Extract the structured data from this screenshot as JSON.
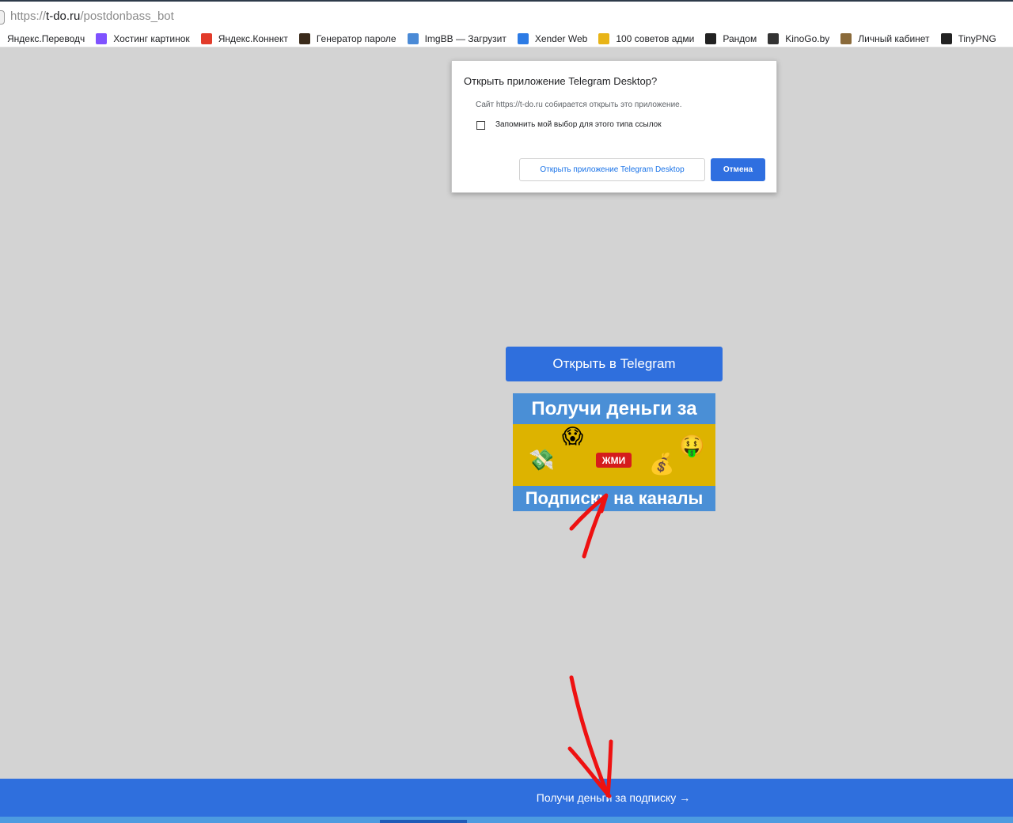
{
  "browser": {
    "url_prefix": "https://",
    "url_host": "t-do.ru",
    "url_path": "/postdonbass_bot",
    "bookmarks": [
      {
        "label": "Яндекс.Переводч",
        "icon": "yandex-translate-icon",
        "color": "#ffffff"
      },
      {
        "label": "Хостинг картинок",
        "icon": "kotlin-k-icon",
        "color": "#7f52ff"
      },
      {
        "label": "Яндекс.Коннект",
        "icon": "yandex-connect-icon",
        "color": "#e23b2a"
      },
      {
        "label": "Генератор пароле",
        "icon": "cookie-icon",
        "color": "#3a2a1a"
      },
      {
        "label": "ImgBB — Загрузит",
        "icon": "imgbb-icon",
        "color": "#4a8ad6"
      },
      {
        "label": "Xender Web",
        "icon": "xender-icon",
        "color": "#2c7be5"
      },
      {
        "label": "100 советов адми",
        "icon": "yellow-folder-icon",
        "color": "#e8b417"
      },
      {
        "label": "Рандом",
        "icon": "r-box-icon",
        "color": "#222222"
      },
      {
        "label": "KinoGo.by",
        "icon": "kinogo-icon",
        "color": "#333333"
      },
      {
        "label": "Личный кабинет",
        "icon": "cabinet-icon",
        "color": "#8a6a3a"
      },
      {
        "label": "TinyPNG",
        "icon": "panda-icon",
        "color": "#222222"
      }
    ]
  },
  "dialog": {
    "title": "Открыть приложение Telegram Desktop?",
    "message": "Сайт https://t-do.ru собирается открыть это приложение.",
    "checkbox_label": "Запомнить мой выбор для этого типа ссылок",
    "open_button": "Открыть приложение Telegram Desktop",
    "cancel_button": "Отмена"
  },
  "page": {
    "open_telegram_button": "Открыть в Telegram",
    "banner": {
      "top_text": "Получи деньги за",
      "badge_text": "ЖМИ",
      "bottom_text": "Подписку на каналы",
      "emojis": {
        "money_wings": "💸",
        "scream": "😱",
        "money_bag": "💰",
        "money_face": "🤑"
      }
    },
    "footer_link": "Получи деньги за подписку →"
  },
  "colors": {
    "primary_blue": "#2f6fdd",
    "banner_blue": "#4a8fd6",
    "banner_yellow": "#ddb300",
    "badge_red": "#d51c1c",
    "annotation_red": "#ee1111",
    "page_background": "#d3d3d3"
  }
}
